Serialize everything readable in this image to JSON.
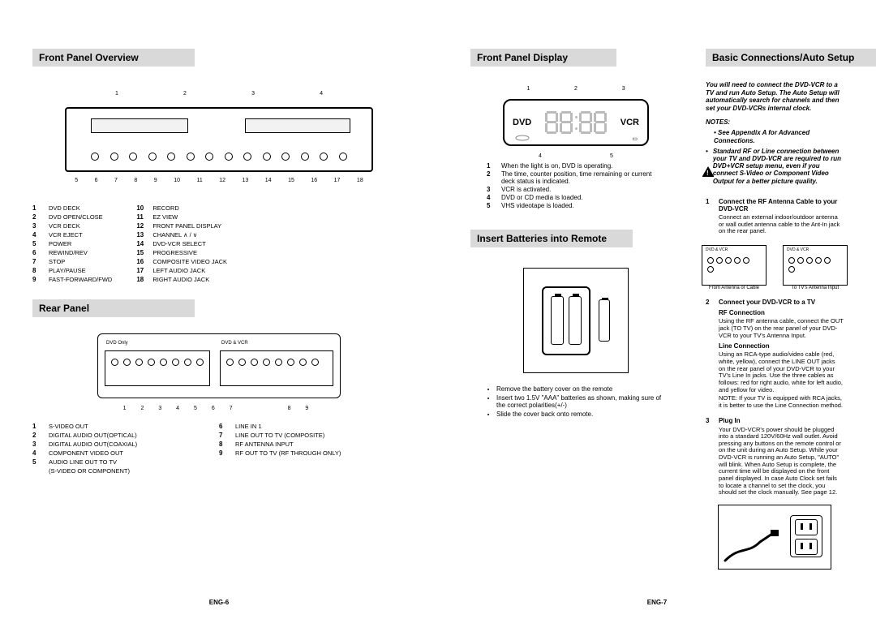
{
  "left": {
    "front_title": "Front Panel Overview",
    "front_callouts_top": [
      "1",
      "2",
      "3",
      "4"
    ],
    "front_callouts_bottom": [
      "5",
      "6",
      "7",
      "8",
      "9",
      "10",
      "11",
      "12",
      "13",
      "14",
      "15",
      "16",
      "17",
      "18"
    ],
    "front_legend_a": [
      {
        "n": "1",
        "t": "DVD DECK"
      },
      {
        "n": "2",
        "t": "DVD OPEN/CLOSE"
      },
      {
        "n": "3",
        "t": "VCR DECK"
      },
      {
        "n": "4",
        "t": "VCR EJECT"
      },
      {
        "n": "5",
        "t": "POWER"
      },
      {
        "n": "6",
        "t": "REWIND/REV"
      },
      {
        "n": "7",
        "t": "STOP"
      },
      {
        "n": "8",
        "t": "PLAY/PAUSE"
      },
      {
        "n": "9",
        "t": "FAST-FORWARD/FWD"
      }
    ],
    "front_legend_b": [
      {
        "n": "10",
        "t": "RECORD"
      },
      {
        "n": "11",
        "t": "EZ VIEW"
      },
      {
        "n": "12",
        "t": "FRONT PANEL DISPLAY"
      },
      {
        "n": "13",
        "t": "CHANNEL ∧ / ∨"
      },
      {
        "n": "14",
        "t": "DVD-VCR SELECT"
      },
      {
        "n": "15",
        "t": "PROGRESSIVE"
      },
      {
        "n": "16",
        "t": "COMPOSITE VIDEO JACK"
      },
      {
        "n": "17",
        "t": "LEFT AUDIO JACK"
      },
      {
        "n": "18",
        "t": "RIGHT AUDIO JACK"
      }
    ],
    "rear_title": "Rear Panel",
    "rear_zone_l": "DVD Only",
    "rear_zone_r": "DVD & VCR",
    "rear_callouts_l": "1   2   3   4   5   6   7",
    "rear_callouts_r": "8   9",
    "rear_legend_a": [
      {
        "n": "1",
        "t": "S-VIDEO OUT"
      },
      {
        "n": "2",
        "t": "DIGITAL AUDIO OUT(OPTICAL)"
      },
      {
        "n": "3",
        "t": "DIGITAL AUDIO OUT(COAXIAL)"
      },
      {
        "n": "4",
        "t": "COMPONENT VIDEO OUT"
      },
      {
        "n": "5",
        "t": "AUDIO LINE OUT TO TV"
      },
      {
        "n": "",
        "t": "(S-VIDEO OR COMPONENT)"
      }
    ],
    "rear_legend_b": [
      {
        "n": "6",
        "t": "LINE IN 1"
      },
      {
        "n": "7",
        "t": "LINE OUT TO TV  (COMPOSITE)"
      },
      {
        "n": "8",
        "t": "RF ANTENNA INPUT"
      },
      {
        "n": "9",
        "t": "RF OUT TO TV (RF THROUGH ONLY)"
      }
    ],
    "page_num": "ENG-6"
  },
  "right": {
    "display_title": "Front Panel Display",
    "disp_left": "DVD",
    "disp_right": "VCR",
    "disp_top": [
      "1",
      "2",
      "3"
    ],
    "disp_bot": [
      "4",
      "5"
    ],
    "disp_legend": [
      {
        "n": "1",
        "t": "When the light is on, DVD is operating."
      },
      {
        "n": "2",
        "t": "The time, counter position, time remaining or current deck status is indicated."
      },
      {
        "n": "3",
        "t": "VCR is activated."
      },
      {
        "n": "4",
        "t": "DVD or CD media is loaded."
      },
      {
        "n": "5",
        "t": "VHS videotape is loaded."
      }
    ],
    "batt_title": "Insert Batteries into Remote",
    "batt_notes": [
      "Remove the battery cover on the remote",
      "Insert two 1.5V \"AAA\" batteries as shown, making sure of the correct polarities(+/-)",
      "Slide the cover back onto remote."
    ],
    "conn_title": "Basic Connections/Auto Setup",
    "intro": "You will need to connect the DVD-VCR to a TV and run Auto Setup. The Auto Setup will automatically search for channels and then set your DVD-VCRs internal clock.",
    "notes_lbl": "NOTES:",
    "note1": "See Appendix A for Advanced Connections.",
    "note2": "Standard RF or Line connection between your TV and DVD-VCR are required to run DVD+VCR setup menu, even if you connect S-Video or Component Video Output for a better picture quality.",
    "diag_l_lbl": "DVD & VCR",
    "diag_l_cap": "From Antenna or Cable",
    "diag_r_lbl": "DVD & VCR",
    "diag_r_cap": "To TV's Antenna Input",
    "step1": {
      "n": "1",
      "head": "Connect the RF Antenna Cable to your DVD-VCR",
      "body": "Connect an external indoor/outdoor antenna or wall outlet antenna cable to the Ant-In jack on the rear panel."
    },
    "step2": {
      "n": "2",
      "head": "Connect your DVD-VCR to a TV",
      "sub1": "RF Connection",
      "body1": "Using the RF antenna cable, connect the OUT jack (TO TV) on the rear panel of your DVD-VCR to your TV's Antenna Input.",
      "sub2": "Line Connection",
      "body2": "Using an RCA-type audio/video cable (red, white, yellow), connect the LINE OUT jacks on the rear panel of your DVD-VCR to your TV's Line In jacks. Use the three cables as follows: red for right audio, white for left audio, and yellow for video.",
      "body2b": "NOTE: If your TV is equipped with RCA jacks, it is better to use the Line Connection method."
    },
    "step3": {
      "n": "3",
      "head": "Plug In",
      "body": "Your DVD-VCR's power should be plugged into a standard 120V/60Hz wall outlet. Avoid pressing any buttons on the remote control or on the unit during an Auto Setup. While your DVD-VCR is running an Auto Setup, \"AUTO\" will blink. When Auto Setup is complete, the current time will be displayed on the front panel displayed. In case Auto Clock set fails to locate a channel to set the clock, you should set the clock manually. See page 12."
    },
    "page_num": "ENG-7"
  }
}
